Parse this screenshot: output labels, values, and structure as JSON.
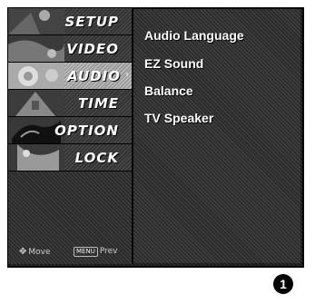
{
  "sidebar": {
    "items": [
      {
        "label": "SETUP",
        "thumb": "setup-thumbnail"
      },
      {
        "label": "VIDEO",
        "thumb": "video-thumbnail"
      },
      {
        "label": "AUDIO",
        "thumb": "audio-thumbnail",
        "active": true
      },
      {
        "label": "TIME",
        "thumb": "time-thumbnail"
      },
      {
        "label": "OPTION",
        "thumb": "option-thumbnail"
      },
      {
        "label": "LOCK",
        "thumb": "lock-thumbnail"
      }
    ],
    "active_indicator": "›"
  },
  "hints": {
    "move_label": "Move",
    "menu_key": "MENU",
    "prev_label": "Prev",
    "move_icon": "move-arrows-icon"
  },
  "submenu": {
    "items": [
      "Audio Language",
      "EZ Sound",
      "Balance",
      "TV Speaker"
    ]
  },
  "figure_number": "1",
  "colors": {
    "panel": "#2b2b2b",
    "active_item": "#9a9a9a",
    "text": "#ffffff",
    "badge": "#000000"
  }
}
